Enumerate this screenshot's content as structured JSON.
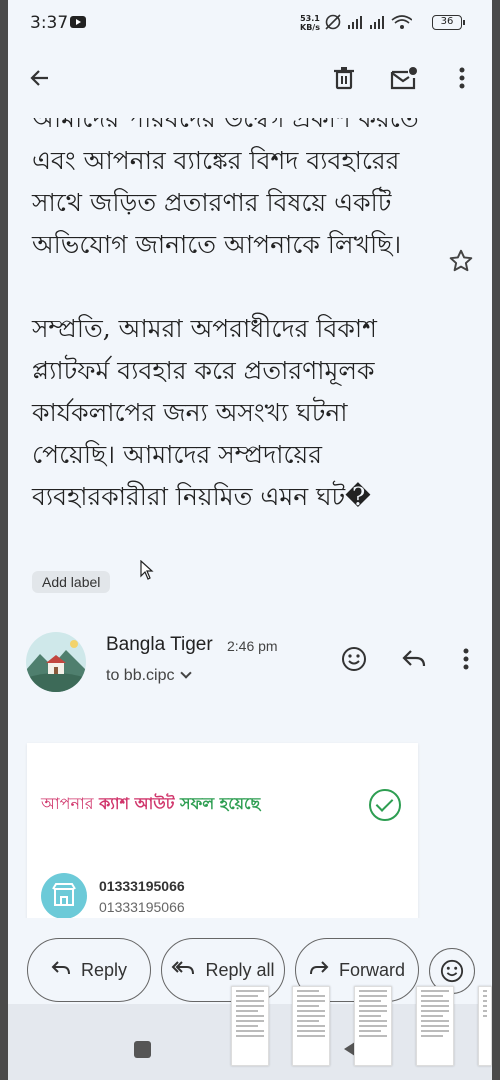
{
  "status_bar": {
    "time": "3:37",
    "net_speed_value": "53.1",
    "net_speed_unit": "KB/s",
    "battery": "36"
  },
  "toolbar": {
    "icons": [
      "back-arrow-icon",
      "delete-icon",
      "mark-unread-icon",
      "more-vert-icon"
    ]
  },
  "email": {
    "body_paragraphs": [
      "আমাদের পরিষদের উদ্বেগ প্রকাশ করতে এবং আপনার ব্যাঙ্কের বিশদ ব্যবহারের সাথে জড়িত প্রতারণার বিষয়ে একটি অভিযোগ জানাতে আপনাকে লিখছি।",
      "সম্প্রতি, আমরা অপরাধীদের বিকাশ প্ল্যাটফর্ম ব্যবহার করে প্রতারণামূলক কার্যকলাপের জন্য অসংখ্য ঘটনা পেয়েছি। আমাদের সম্প্রদায়ের ব্যবহারকারীরা নিয়মিত এমন ঘট�"
    ],
    "add_label": "Add label"
  },
  "message": {
    "sender_name": "Bangla Tiger",
    "time": "2:46 pm",
    "recipient": "to bb.cipc",
    "card": {
      "title_part1": "আপনার",
      "title_part2": "ক্যাশ আউট",
      "title_part3": "সফল হয়েছে",
      "number1": "01333195066",
      "number2": "01333195066"
    }
  },
  "actions": {
    "reply": "Reply",
    "reply_all": "Reply all",
    "forward": "Forward"
  },
  "colors": {
    "accent_pink": "#d0356b",
    "accent_green": "#2e9e52",
    "background": "#f2f6fb"
  }
}
